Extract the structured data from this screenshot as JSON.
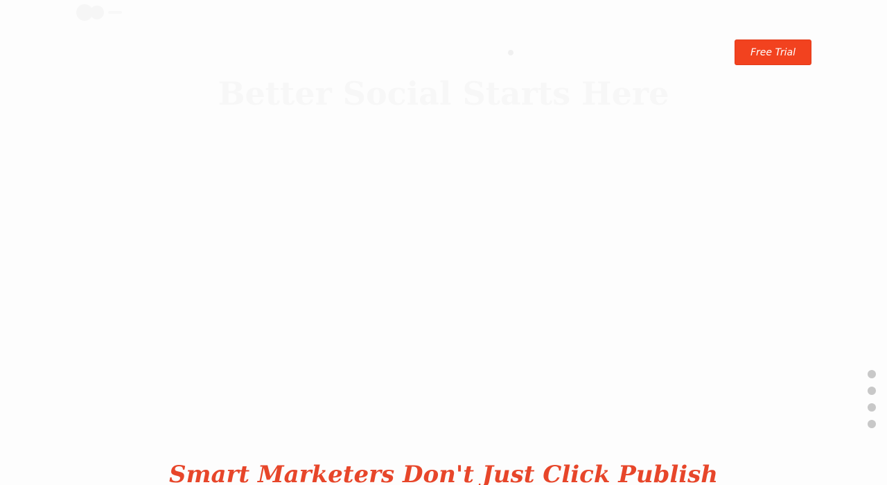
{
  "header": {
    "logo_icon": "brand-logo-icon",
    "free_trial_label": "Free Trial",
    "accent_color": "#f2421f"
  },
  "hero": {
    "title": "Better Social Starts Here",
    "subtitle_line1": "",
    "subtitle_line2": ""
  },
  "side_nav": {
    "dots": [
      "",
      "",
      "",
      ""
    ]
  },
  "section": {
    "heading": "Smart Marketers Don't Just Click Publish",
    "heading_color": "#e7462a"
  }
}
